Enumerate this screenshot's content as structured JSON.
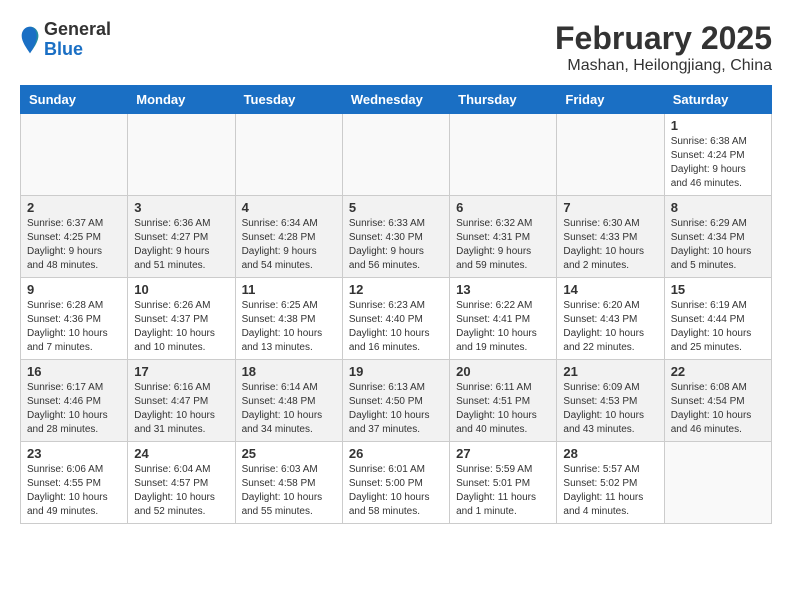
{
  "header": {
    "logo_general": "General",
    "logo_blue": "Blue",
    "month_year": "February 2025",
    "location": "Mashan, Heilongjiang, China"
  },
  "weekdays": [
    "Sunday",
    "Monday",
    "Tuesday",
    "Wednesday",
    "Thursday",
    "Friday",
    "Saturday"
  ],
  "weeks": [
    [
      {
        "day": "",
        "info": ""
      },
      {
        "day": "",
        "info": ""
      },
      {
        "day": "",
        "info": ""
      },
      {
        "day": "",
        "info": ""
      },
      {
        "day": "",
        "info": ""
      },
      {
        "day": "",
        "info": ""
      },
      {
        "day": "1",
        "info": "Sunrise: 6:38 AM\nSunset: 4:24 PM\nDaylight: 9 hours and 46 minutes."
      }
    ],
    [
      {
        "day": "2",
        "info": "Sunrise: 6:37 AM\nSunset: 4:25 PM\nDaylight: 9 hours and 48 minutes."
      },
      {
        "day": "3",
        "info": "Sunrise: 6:36 AM\nSunset: 4:27 PM\nDaylight: 9 hours and 51 minutes."
      },
      {
        "day": "4",
        "info": "Sunrise: 6:34 AM\nSunset: 4:28 PM\nDaylight: 9 hours and 54 minutes."
      },
      {
        "day": "5",
        "info": "Sunrise: 6:33 AM\nSunset: 4:30 PM\nDaylight: 9 hours and 56 minutes."
      },
      {
        "day": "6",
        "info": "Sunrise: 6:32 AM\nSunset: 4:31 PM\nDaylight: 9 hours and 59 minutes."
      },
      {
        "day": "7",
        "info": "Sunrise: 6:30 AM\nSunset: 4:33 PM\nDaylight: 10 hours and 2 minutes."
      },
      {
        "day": "8",
        "info": "Sunrise: 6:29 AM\nSunset: 4:34 PM\nDaylight: 10 hours and 5 minutes."
      }
    ],
    [
      {
        "day": "9",
        "info": "Sunrise: 6:28 AM\nSunset: 4:36 PM\nDaylight: 10 hours and 7 minutes."
      },
      {
        "day": "10",
        "info": "Sunrise: 6:26 AM\nSunset: 4:37 PM\nDaylight: 10 hours and 10 minutes."
      },
      {
        "day": "11",
        "info": "Sunrise: 6:25 AM\nSunset: 4:38 PM\nDaylight: 10 hours and 13 minutes."
      },
      {
        "day": "12",
        "info": "Sunrise: 6:23 AM\nSunset: 4:40 PM\nDaylight: 10 hours and 16 minutes."
      },
      {
        "day": "13",
        "info": "Sunrise: 6:22 AM\nSunset: 4:41 PM\nDaylight: 10 hours and 19 minutes."
      },
      {
        "day": "14",
        "info": "Sunrise: 6:20 AM\nSunset: 4:43 PM\nDaylight: 10 hours and 22 minutes."
      },
      {
        "day": "15",
        "info": "Sunrise: 6:19 AM\nSunset: 4:44 PM\nDaylight: 10 hours and 25 minutes."
      }
    ],
    [
      {
        "day": "16",
        "info": "Sunrise: 6:17 AM\nSunset: 4:46 PM\nDaylight: 10 hours and 28 minutes."
      },
      {
        "day": "17",
        "info": "Sunrise: 6:16 AM\nSunset: 4:47 PM\nDaylight: 10 hours and 31 minutes."
      },
      {
        "day": "18",
        "info": "Sunrise: 6:14 AM\nSunset: 4:48 PM\nDaylight: 10 hours and 34 minutes."
      },
      {
        "day": "19",
        "info": "Sunrise: 6:13 AM\nSunset: 4:50 PM\nDaylight: 10 hours and 37 minutes."
      },
      {
        "day": "20",
        "info": "Sunrise: 6:11 AM\nSunset: 4:51 PM\nDaylight: 10 hours and 40 minutes."
      },
      {
        "day": "21",
        "info": "Sunrise: 6:09 AM\nSunset: 4:53 PM\nDaylight: 10 hours and 43 minutes."
      },
      {
        "day": "22",
        "info": "Sunrise: 6:08 AM\nSunset: 4:54 PM\nDaylight: 10 hours and 46 minutes."
      }
    ],
    [
      {
        "day": "23",
        "info": "Sunrise: 6:06 AM\nSunset: 4:55 PM\nDaylight: 10 hours and 49 minutes."
      },
      {
        "day": "24",
        "info": "Sunrise: 6:04 AM\nSunset: 4:57 PM\nDaylight: 10 hours and 52 minutes."
      },
      {
        "day": "25",
        "info": "Sunrise: 6:03 AM\nSunset: 4:58 PM\nDaylight: 10 hours and 55 minutes."
      },
      {
        "day": "26",
        "info": "Sunrise: 6:01 AM\nSunset: 5:00 PM\nDaylight: 10 hours and 58 minutes."
      },
      {
        "day": "27",
        "info": "Sunrise: 5:59 AM\nSunset: 5:01 PM\nDaylight: 11 hours and 1 minute."
      },
      {
        "day": "28",
        "info": "Sunrise: 5:57 AM\nSunset: 5:02 PM\nDaylight: 11 hours and 4 minutes."
      },
      {
        "day": "",
        "info": ""
      }
    ]
  ]
}
